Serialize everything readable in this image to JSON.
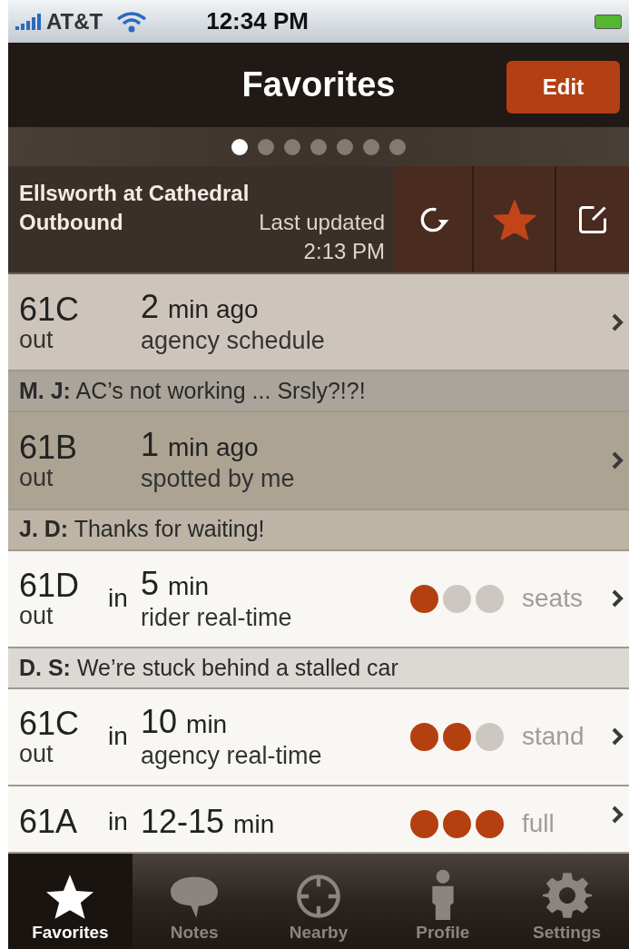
{
  "status_bar": {
    "carrier": "AT&T",
    "time": "12:34 PM"
  },
  "nav": {
    "title": "Favorites",
    "edit_button": "Edit"
  },
  "pager": {
    "pages": [
      {
        "selected": true
      },
      {
        "selected": false
      },
      {
        "selected": false
      },
      {
        "selected": false
      },
      {
        "selected": false
      },
      {
        "selected": false
      },
      {
        "selected": false
      }
    ]
  },
  "stop": {
    "name": "Ellsworth at Cathedral",
    "direction": "Outbound",
    "updated_label": "Last updated",
    "updated_time": "2:13 PM",
    "favorite": true
  },
  "rows": [
    {
      "kind": "arrival",
      "route": "61C",
      "direction": "out",
      "value": "2",
      "unit": "min ago",
      "source": "agency schedule",
      "color": "#cdc5bb"
    },
    {
      "kind": "note",
      "author": "M. J:",
      "text": "AC’s not working ... Srsly?!?!",
      "color": "#aaa49b"
    },
    {
      "kind": "arrival",
      "route": "61B",
      "direction": "out",
      "value": "1",
      "unit": "min ago",
      "source": "spotted by me",
      "color": "#aca392"
    },
    {
      "kind": "note",
      "author": "J. D:",
      "text": "Thanks for waiting!",
      "color": "#bdb4a5"
    },
    {
      "kind": "arrival",
      "route": "61D",
      "direction": "out",
      "prefix": "in",
      "value": "5",
      "unit": "min",
      "source": "rider real-time",
      "color": "#f8f7f3",
      "crowd": {
        "stars": 1,
        "label": "seats"
      }
    },
    {
      "kind": "note",
      "author": "D. S:",
      "text": "We’re stuck behind a stalled car",
      "color": "#dcd9d4"
    },
    {
      "kind": "arrival",
      "route": "61C",
      "direction": "out",
      "prefix": "in",
      "value": "10",
      "unit": "min",
      "source": "agency real-time",
      "color": "#f8f7f3",
      "crowd": {
        "stars": 2,
        "label": "stand"
      }
    },
    {
      "kind": "arrival",
      "route": "61A",
      "prefix": "in",
      "value": "12-15",
      "unit": "min",
      "color": "#f8f7f3",
      "crowd": {
        "stars": 3,
        "label": "full"
      }
    }
  ],
  "tab_bar": [
    {
      "kind": "star",
      "label": "Favorites",
      "selected": true
    },
    {
      "kind": "bubble",
      "label": "Notes",
      "selected": false
    },
    {
      "kind": "target",
      "label": "Nearby",
      "selected": false
    },
    {
      "kind": "person",
      "label": "Profile",
      "selected": false
    },
    {
      "kind": "gear",
      "label": "Settings",
      "selected": false
    }
  ]
}
